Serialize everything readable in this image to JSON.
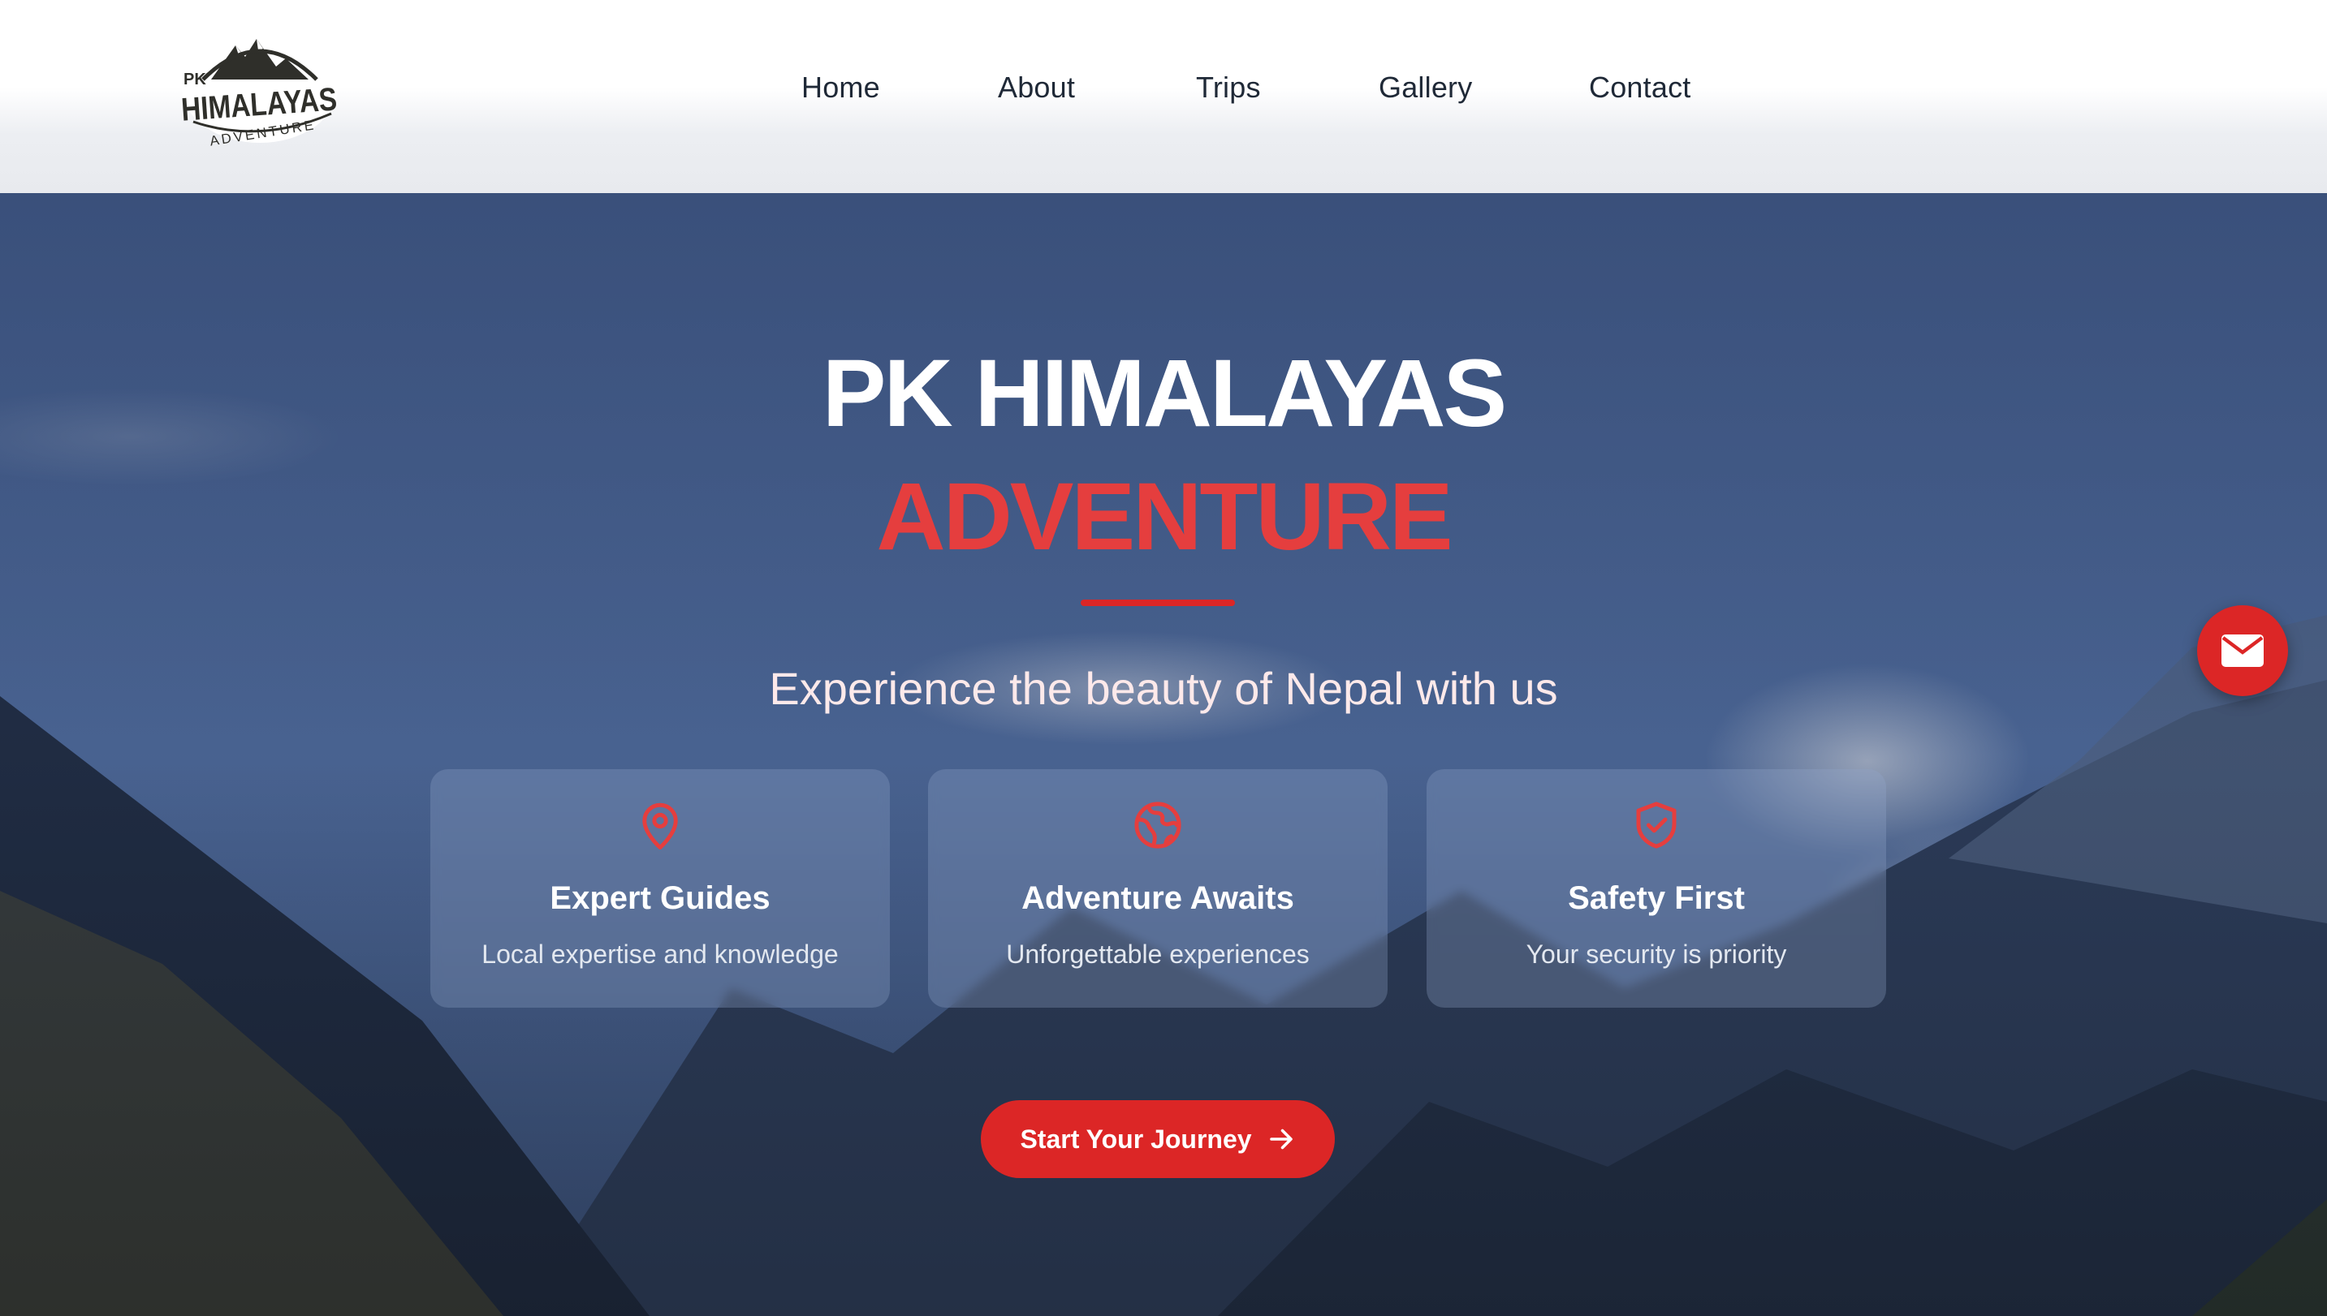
{
  "header": {
    "logo": {
      "top": "PK",
      "main": "HIMALAYAS",
      "sub": "ADVENTURE",
      "icon": "mountain-logo"
    },
    "nav": [
      {
        "label": "Home"
      },
      {
        "label": "About"
      },
      {
        "label": "Trips"
      },
      {
        "label": "Gallery"
      },
      {
        "label": "Contact"
      }
    ]
  },
  "hero": {
    "title_line1": "PK HIMALAYAS",
    "title_line2": "ADVENTURE",
    "subtitle": "Experience the beauty of Nepal with us",
    "features": [
      {
        "icon": "map-pin-icon",
        "title": "Expert Guides",
        "description": "Local expertise and knowledge"
      },
      {
        "icon": "globe-icon",
        "title": "Adventure Awaits",
        "description": "Unforgettable experiences"
      },
      {
        "icon": "shield-check-icon",
        "title": "Safety First",
        "description": "Your security is priority"
      }
    ],
    "cta_label": "Start Your Journey",
    "cta_icon": "arrow-right-icon"
  },
  "floating_button": {
    "icon": "envelope-icon"
  },
  "colors": {
    "accent": "#dc2626",
    "title_accent": "#e53e3e",
    "text_dark": "#1f2937"
  }
}
